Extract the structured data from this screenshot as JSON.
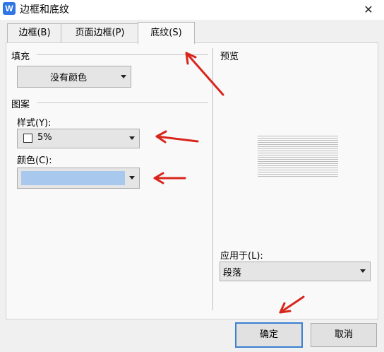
{
  "window": {
    "title": "边框和底纹",
    "app_icon": "W",
    "close_glyph": "✕"
  },
  "tabs": [
    {
      "label": "边框(B)",
      "active": false
    },
    {
      "label": "页面边框(P)",
      "active": false
    },
    {
      "label": "底纹(S)",
      "active": true
    }
  ],
  "fill": {
    "section_label": "填充",
    "color_value": "没有颜色"
  },
  "pattern": {
    "section_label": "图案",
    "style_label": "样式(Y):",
    "style_value": "5%",
    "color_label": "颜色(C):",
    "color_swatch": "#a8c8ee"
  },
  "preview": {
    "section_label": "预览"
  },
  "apply_to": {
    "label": "应用于(L):",
    "value": "段落"
  },
  "buttons": {
    "ok": "确定",
    "cancel": "取消"
  },
  "annotation_color": "#d8261d"
}
